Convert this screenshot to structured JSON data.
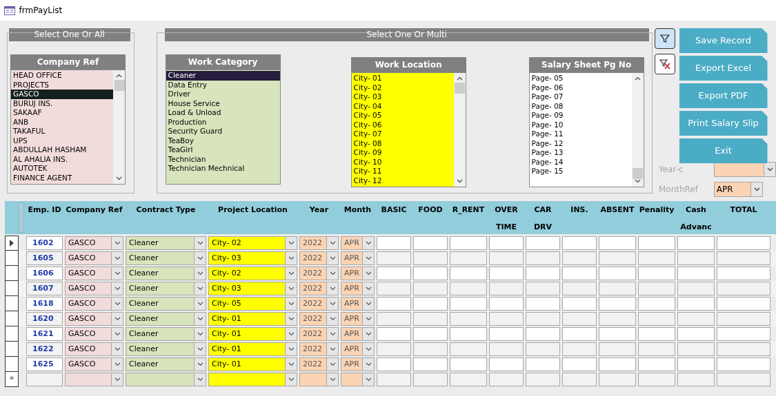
{
  "window": {
    "title": "frmPayList"
  },
  "select_one_or_all": {
    "title": "Select One Or All",
    "lists": [
      {
        "title": "Company Ref",
        "color": "#f2dcdb",
        "scrollable": true,
        "items": [
          {
            "label": "HEAD OFFICE",
            "selected": false
          },
          {
            "label": "PROJECTS",
            "selected": false
          },
          {
            "label": "GASCO",
            "selected": true
          },
          {
            "label": "BURUJ INS.",
            "selected": false
          },
          {
            "label": "SAKAAF",
            "selected": false
          },
          {
            "label": "ANB",
            "selected": false
          },
          {
            "label": "TAKAFUL",
            "selected": false
          },
          {
            "label": "UPS",
            "selected": false
          },
          {
            "label": "ABDULLAH HASHAM",
            "selected": false
          },
          {
            "label": "AL AHALIA INS.",
            "selected": false
          },
          {
            "label": "AUTOTEK",
            "selected": false
          },
          {
            "label": "FINANCE AGENT",
            "selected": false
          }
        ]
      }
    ]
  },
  "select_one_or_multi": {
    "title": "Select One Or Multi",
    "lists": [
      {
        "title": "Work Category",
        "color": "#d7e4bc",
        "scrollable": false,
        "items": [
          {
            "label": "Cleaner",
            "selected": true
          },
          {
            "label": "Data Entry",
            "selected": false
          },
          {
            "label": "Driver",
            "selected": false
          },
          {
            "label": "House Service",
            "selected": false
          },
          {
            "label": "Load & Unload",
            "selected": false
          },
          {
            "label": "Production",
            "selected": false
          },
          {
            "label": "Security Guard",
            "selected": false
          },
          {
            "label": "TeaBoy",
            "selected": false
          },
          {
            "label": "TeaGirl",
            "selected": false
          },
          {
            "label": "Technician",
            "selected": false
          },
          {
            "label": "Technician Mechnical",
            "selected": false
          }
        ]
      },
      {
        "title": "Work Location",
        "color": "#ffff00",
        "scrollable": true,
        "items": [
          {
            "label": "City- 01",
            "selected": false
          },
          {
            "label": "City- 02",
            "selected": false
          },
          {
            "label": "City- 03",
            "selected": false
          },
          {
            "label": "City- 04",
            "selected": false
          },
          {
            "label": "City- 05",
            "selected": false
          },
          {
            "label": "City- 06",
            "selected": false
          },
          {
            "label": "City- 07",
            "selected": false
          },
          {
            "label": "City- 08",
            "selected": false
          },
          {
            "label": "City- 09",
            "selected": false
          },
          {
            "label": "City- 10",
            "selected": false
          },
          {
            "label": "City- 11",
            "selected": false
          },
          {
            "label": "City- 12",
            "selected": false
          }
        ]
      },
      {
        "title": "Salary Sheet Pg No",
        "color": "#ffffff",
        "scrollable": true,
        "items": [
          {
            "label": "Page- 05",
            "selected": false
          },
          {
            "label": "Page- 06",
            "selected": false
          },
          {
            "label": "Page- 07",
            "selected": false
          },
          {
            "label": "Page- 08",
            "selected": false
          },
          {
            "label": "Page- 09",
            "selected": false
          },
          {
            "label": "Page- 10",
            "selected": false
          },
          {
            "label": "Page- 11",
            "selected": false
          },
          {
            "label": "Page- 12",
            "selected": false
          },
          {
            "label": "Page- 13",
            "selected": false
          },
          {
            "label": "Page- 14",
            "selected": false
          },
          {
            "label": "Page- 15",
            "selected": false
          }
        ]
      }
    ]
  },
  "filter_tools": [
    {
      "kind": "filter",
      "selected": true
    },
    {
      "kind": "clear",
      "selected": false
    }
  ],
  "buttons": [
    "Save Record",
    "Export Excel",
    "Export PDF",
    "Print Salary Slip",
    "Exit"
  ],
  "year_c": {
    "label": "Year-c"
  },
  "month_ref": {
    "label": "MonthRef",
    "value": "APR"
  },
  "grid": {
    "columns": [
      {
        "kind": "id",
        "lines": [
          "Emp. ID"
        ]
      },
      {
        "kind": "combo",
        "lines": [
          "Company Ref"
        ],
        "color": "#f2dcdb"
      },
      {
        "kind": "combo",
        "lines": [
          "Contract Type"
        ],
        "color": "#d7e4bc"
      },
      {
        "kind": "combo",
        "lines": [
          "Project Location"
        ],
        "color": "#ffff00"
      },
      {
        "kind": "combo",
        "lines": [
          "Year"
        ],
        "color": "#fbd4b4"
      },
      {
        "kind": "combo",
        "lines": [
          "Month"
        ],
        "color": "#fbd4b4"
      },
      {
        "kind": "number",
        "lines": [
          "BASIC"
        ]
      },
      {
        "kind": "number",
        "lines": [
          "FOOD"
        ]
      },
      {
        "kind": "number",
        "lines": [
          "R_RENT"
        ]
      },
      {
        "kind": "number",
        "lines": [
          "OVER",
          "TIME"
        ]
      },
      {
        "kind": "number",
        "lines": [
          "CAR",
          "DRV"
        ]
      },
      {
        "kind": "number",
        "lines": [
          "INS."
        ]
      },
      {
        "kind": "number",
        "lines": [
          "ABSENT"
        ]
      },
      {
        "kind": "number",
        "lines": [
          "Penality"
        ]
      },
      {
        "kind": "number",
        "lines": [
          "Cash",
          "Advanc"
        ]
      },
      {
        "kind": "number",
        "lines": [
          "TOTAL"
        ]
      }
    ],
    "rows": [
      {
        "current": true,
        "cells": [
          "1602",
          "GASCO",
          "Cleaner",
          "City- 02",
          "2022",
          "APR"
        ]
      },
      {
        "current": false,
        "cells": [
          "1605",
          "GASCO",
          "Cleaner",
          "City- 03",
          "2022",
          "APR"
        ]
      },
      {
        "current": false,
        "cells": [
          "1606",
          "GASCO",
          "Cleaner",
          "City- 02",
          "2022",
          "APR"
        ]
      },
      {
        "current": false,
        "cells": [
          "1607",
          "GASCO",
          "Cleaner",
          "City- 03",
          "2022",
          "APR"
        ]
      },
      {
        "current": false,
        "cells": [
          "1618",
          "GASCO",
          "Cleaner",
          "City- 05",
          "2022",
          "APR"
        ]
      },
      {
        "current": false,
        "cells": [
          "1620",
          "GASCO",
          "Cleaner",
          "City- 01",
          "2022",
          "APR"
        ]
      },
      {
        "current": false,
        "cells": [
          "1621",
          "GASCO",
          "Cleaner",
          "City- 01",
          "2022",
          "APR"
        ]
      },
      {
        "current": false,
        "cells": [
          "1622",
          "GASCO",
          "Cleaner",
          "City- 01",
          "2022",
          "APR"
        ]
      },
      {
        "current": false,
        "cells": [
          "1625",
          "GASCO",
          "Cleaner",
          "City- 01",
          "2022",
          "APR"
        ]
      }
    ],
    "new_row": {
      "marker": "*"
    }
  }
}
